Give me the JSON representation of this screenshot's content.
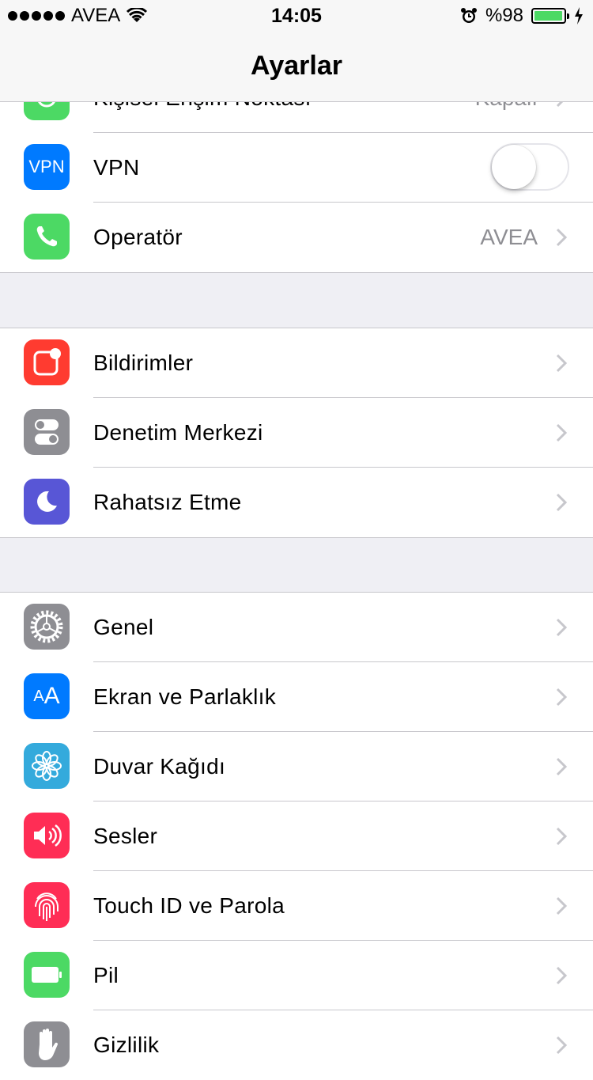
{
  "status_bar": {
    "carrier": "AVEA",
    "time": "14:05",
    "battery": "%98",
    "battery_level": 0.98,
    "icons": [
      "signal-dots",
      "wifi-icon",
      "alarm-icon",
      "battery-icon",
      "charging-icon"
    ]
  },
  "nav": {
    "title": "Ayarlar"
  },
  "colors": {
    "green": "#4cd964",
    "blue": "#007aff",
    "red": "#ff3b30",
    "gray": "#8e8e93",
    "purple": "#5856d6",
    "teal": "#34aadc",
    "pink": "#ff2d55"
  },
  "group1": [
    {
      "label": "Kişisel Erişim Noktası",
      "value": "Kapalı",
      "icon": "hotspot-icon"
    },
    {
      "label": "VPN",
      "icon_text": "VPN",
      "toggle": false
    },
    {
      "label": "Operatör",
      "value": "AVEA",
      "icon": "phone-icon"
    }
  ],
  "group2": [
    {
      "label": "Bildirimler",
      "icon": "notifications-icon"
    },
    {
      "label": "Denetim Merkezi",
      "icon": "control-center-icon"
    },
    {
      "label": "Rahatsız Etme",
      "icon": "moon-icon"
    }
  ],
  "group3": [
    {
      "label": "Genel",
      "icon": "gear-icon"
    },
    {
      "label": "Ekran ve Parlaklık",
      "icon_text": "AA",
      "icon": "display-icon"
    },
    {
      "label": "Duvar Kağıdı",
      "icon": "wallpaper-icon"
    },
    {
      "label": "Sesler",
      "icon": "sound-icon"
    },
    {
      "label": "Touch ID ve Parola",
      "icon": "fingerprint-icon"
    },
    {
      "label": "Pil",
      "icon": "battery-icon"
    },
    {
      "label": "Gizlilik",
      "icon": "hand-icon"
    }
  ]
}
